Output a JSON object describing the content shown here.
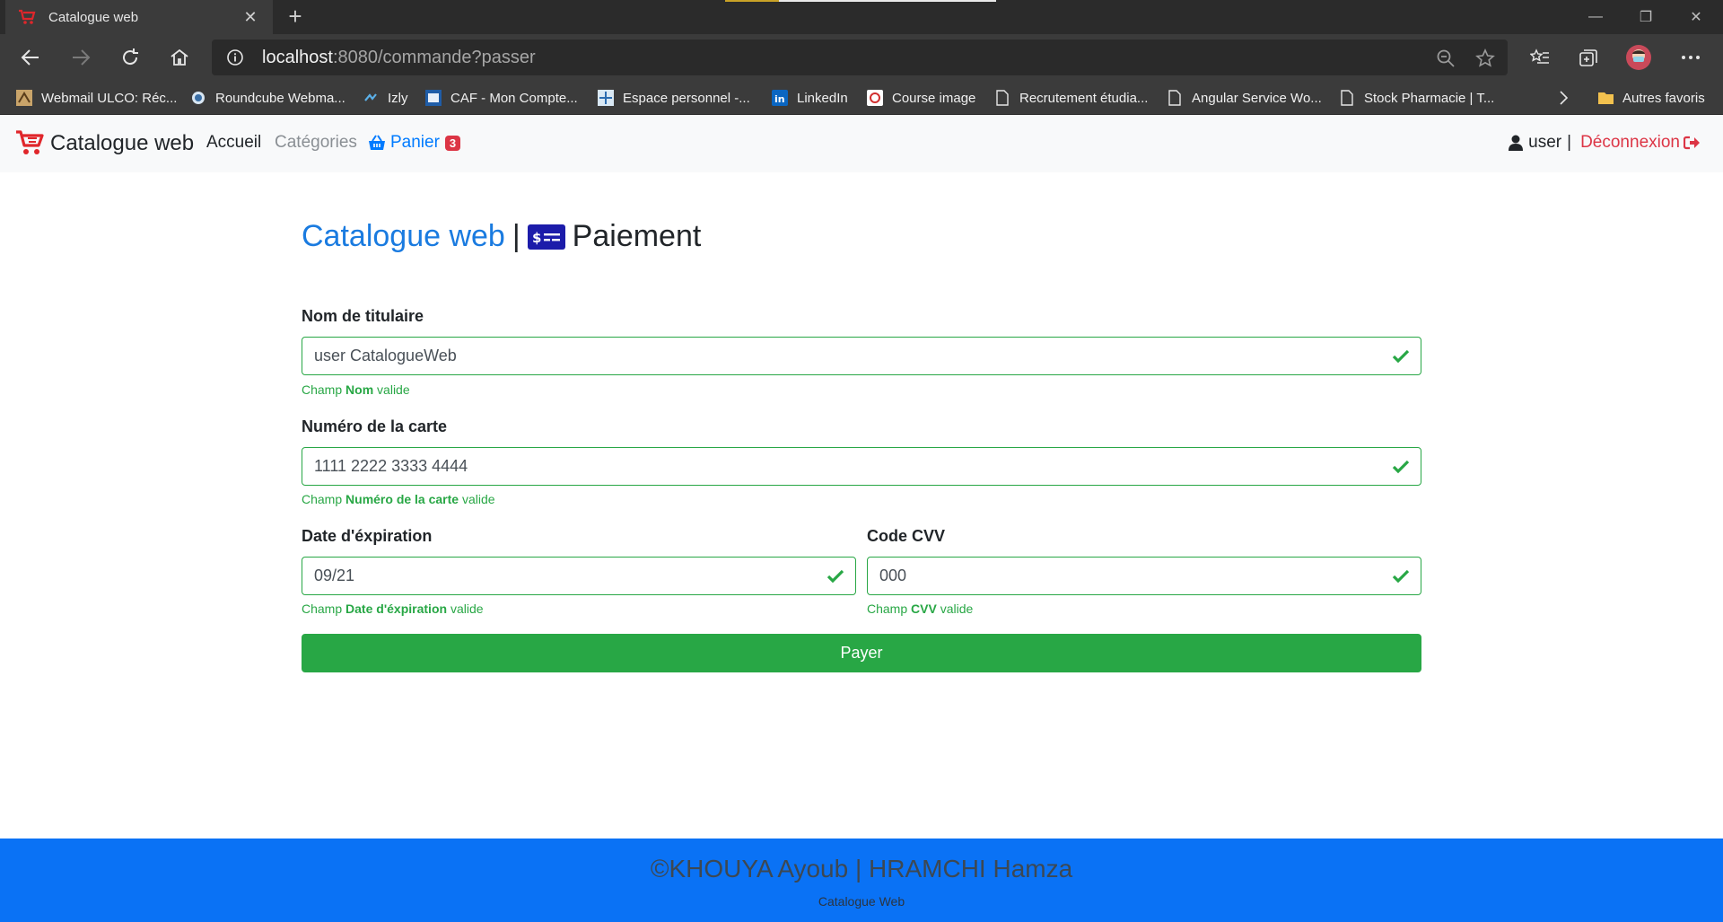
{
  "browser": {
    "tab_title": "Catalogue web",
    "url_host": "localhost",
    "url_rest": ":8080/commande?passer",
    "bookmarks": [
      {
        "label": "Webmail ULCO: Réc...",
        "icon": "ulco-icon"
      },
      {
        "label": "Roundcube Webma...",
        "icon": "roundcube-icon"
      },
      {
        "label": "Izly",
        "icon": "izly-icon"
      },
      {
        "label": "CAF - Mon Compte...",
        "icon": "caf-icon"
      },
      {
        "label": "Espace personnel -...",
        "icon": "espace-icon"
      },
      {
        "label": "LinkedIn",
        "icon": "linkedin-icon"
      },
      {
        "label": "Course image",
        "icon": "course-icon"
      },
      {
        "label": "Recrutement étudia...",
        "icon": "page-icon"
      },
      {
        "label": "Angular Service Wo...",
        "icon": "page-icon"
      },
      {
        "label": "Stock Pharmacie | T...",
        "icon": "page-icon"
      }
    ],
    "other_favorites": "Autres favoris"
  },
  "navbar": {
    "brand": "Catalogue web",
    "home": "Accueil",
    "categories": "Catégories",
    "cart": "Panier",
    "cart_count": "3",
    "user": "user",
    "separator": "|",
    "logout": "Déconnexion"
  },
  "page": {
    "title_brand": "Catalogue web",
    "title_separator": "|",
    "title": "Paiement"
  },
  "form": {
    "holder": {
      "label": "Nom de titulaire",
      "value": "user CatalogueWeb",
      "feedback_prefix": "Champ",
      "feedback_field": "Nom",
      "feedback_suffix": "valide"
    },
    "card_number": {
      "label": "Numéro de la carte",
      "value": "1111 2222 3333 4444",
      "feedback_prefix": "Champ",
      "feedback_field": "Numéro de la carte",
      "feedback_suffix": "valide"
    },
    "expiry": {
      "label": "Date d'éxpiration",
      "value": "09/21",
      "feedback_prefix": "Champ",
      "feedback_field": "Date d'éxpiration",
      "feedback_suffix": "valide"
    },
    "cvv": {
      "label": "Code CVV",
      "value": "000",
      "feedback_prefix": "Champ",
      "feedback_field": "CVV",
      "feedback_suffix": "valide"
    },
    "submit": "Payer"
  },
  "footer": {
    "authors": "©KHOUYA Ayoub | HRAMCHI Hamza",
    "caption": "Catalogue Web"
  },
  "colors": {
    "primary": "#007bff",
    "success": "#28a745",
    "danger": "#dc3545",
    "footer_bg": "#0a72f5"
  }
}
